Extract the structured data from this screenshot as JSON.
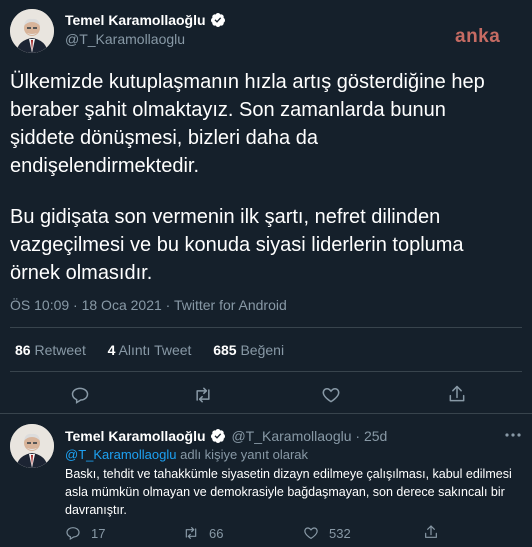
{
  "main_tweet": {
    "author_name": "Temel Karamollaoğlu",
    "author_handle": "@T_Karamollaoglu",
    "paragraph1": "Ülkemizde kutuplaşmanın hızla artış gösterdiğine hep beraber şahit olmaktayız. Son zamanlarda bunun şiddete dönüşmesi, bizleri daha da endişelendirmektedir.",
    "paragraph2": "Bu gidişata son vermenin ilk şartı, nefret dilinden vazgeçilmesi ve bu konuda siyasi liderlerin topluma örnek olmasıdır.",
    "meta": "ÖS 10:09 · 18 Oca 2021 · Twitter for Android",
    "retweets_count": "86",
    "retweets_label": "Retweet",
    "quotes_count": "4",
    "quotes_label": "Alıntı Tweet",
    "likes_count": "685",
    "likes_label": "Beğeni"
  },
  "watermark": "anka",
  "reply_tweet": {
    "author_name": "Temel Karamollaoğlu",
    "author_handle": "@T_Karamollaoglu",
    "separator": "·",
    "age": "25d",
    "reply_to_handle": "@T_Karamollaoglu",
    "reply_to_suffix": "adlı kişiye yanıt olarak",
    "text": "Baskı, tehdit ve tahakkümle siyasetin dizayn edilmeye çalışılması, kabul edilmesi asla mümkün olmayan ve demokrasiyle bağdaşmayan, son derece sakıncalı bir davranıştır.",
    "reply_count": "17",
    "retweet_count": "66",
    "like_count": "532"
  },
  "colors": {
    "background": "#15202b",
    "accent": "#1da1f2",
    "muted": "#8899a6",
    "divider": "#38444d"
  }
}
